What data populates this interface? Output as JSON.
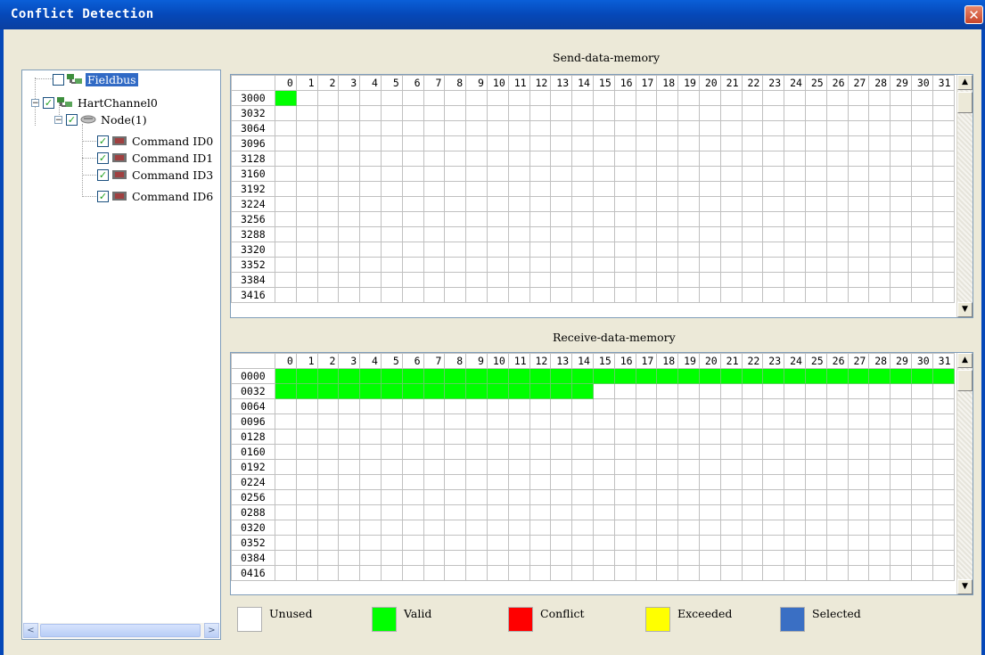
{
  "window": {
    "title": "Conflict Detection"
  },
  "tree": [
    {
      "label": "Fieldbus",
      "checked": false,
      "selected": true
    },
    {
      "label": "HartChannel0",
      "checked": true,
      "selected": false
    },
    {
      "label": "Node(1)",
      "checked": true,
      "selected": false
    },
    {
      "label": "Command ID0",
      "checked": true,
      "selected": false
    },
    {
      "label": "Command ID1",
      "checked": true,
      "selected": false
    },
    {
      "label": "Command ID3",
      "checked": true,
      "selected": false
    },
    {
      "label": "Command ID6",
      "checked": true,
      "selected": false
    }
  ],
  "send": {
    "title": "Send-data-memory",
    "columns": [
      "0",
      "1",
      "2",
      "3",
      "4",
      "5",
      "6",
      "7",
      "8",
      "9",
      "10",
      "11",
      "12",
      "13",
      "14",
      "15",
      "16",
      "17",
      "18",
      "19",
      "20",
      "21",
      "22",
      "23",
      "24",
      "25",
      "26",
      "27",
      "28",
      "29",
      "30",
      "31"
    ],
    "rows": [
      "3000",
      "3032",
      "3064",
      "3096",
      "3128",
      "3160",
      "3192",
      "3224",
      "3256",
      "3288",
      "3320",
      "3352",
      "3384",
      "3416"
    ],
    "used_bytes": 1
  },
  "receive": {
    "title": "Receive-data-memory",
    "columns": [
      "0",
      "1",
      "2",
      "3",
      "4",
      "5",
      "6",
      "7",
      "8",
      "9",
      "10",
      "11",
      "12",
      "13",
      "14",
      "15",
      "16",
      "17",
      "18",
      "19",
      "20",
      "21",
      "22",
      "23",
      "24",
      "25",
      "26",
      "27",
      "28",
      "29",
      "30",
      "31"
    ],
    "rows": [
      "0000",
      "0032",
      "0064",
      "0096",
      "0128",
      "0160",
      "0192",
      "0224",
      "0256",
      "0288",
      "0320",
      "0352",
      "0384",
      "0416"
    ],
    "used_bytes": 47
  },
  "legend": [
    {
      "label": "Unused",
      "color": "#ffffff"
    },
    {
      "label": "Valid",
      "color": "#00ff00"
    },
    {
      "label": "Conflict",
      "color": "#ff0000"
    },
    {
      "label": "Exceeded",
      "color": "#ffff00"
    },
    {
      "label": "Selected",
      "color": "#3a6fc4"
    }
  ],
  "scroll": {
    "left": "<",
    "right": ">",
    "up": "▲",
    "down": "▼"
  }
}
